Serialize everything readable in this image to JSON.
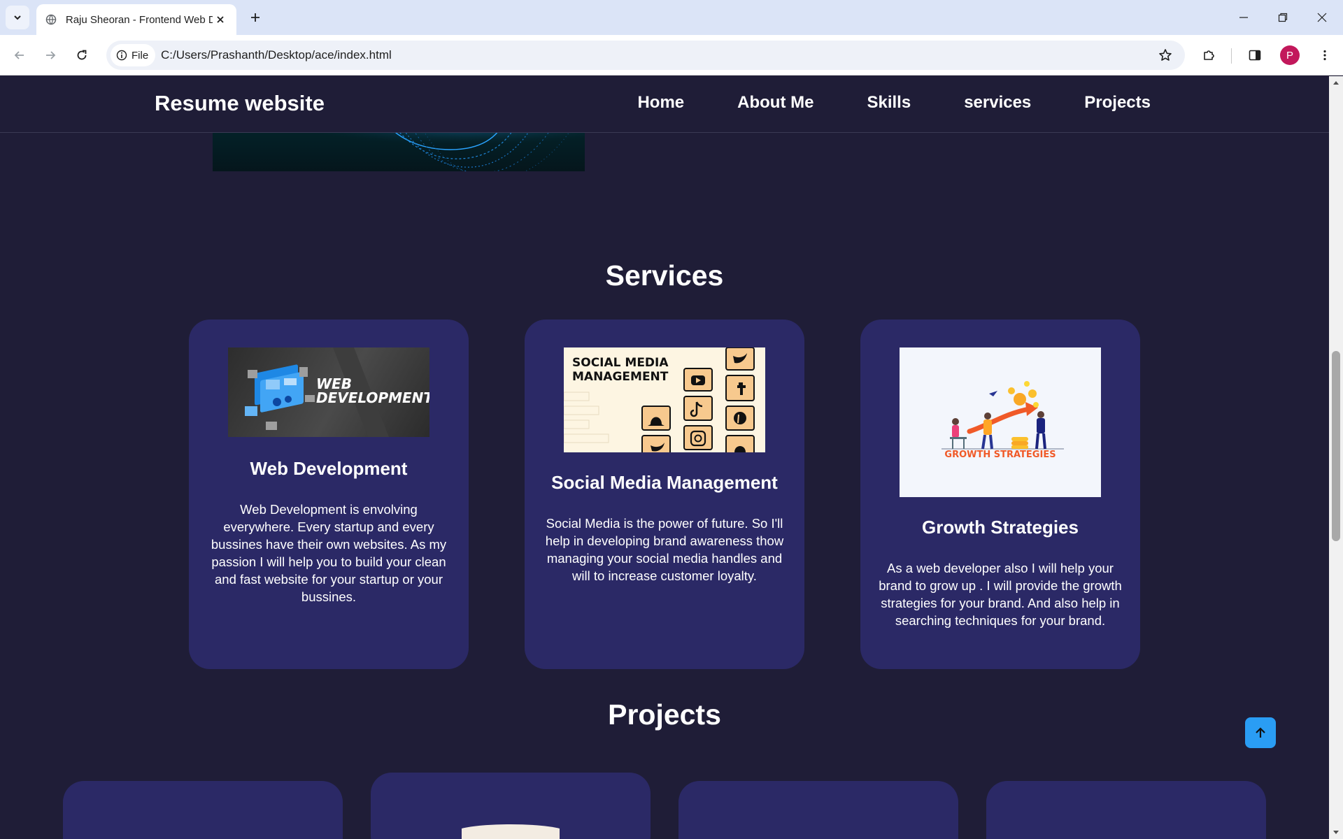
{
  "browser": {
    "tab_title": "Raju Sheoran - Frontend Web D",
    "chip_label": "File",
    "url": "C:/Users/Prashanth/Desktop/ace/index.html",
    "profile_initial": "P"
  },
  "site": {
    "brand": "Resume website",
    "nav": [
      "Home",
      "About Me",
      "Skills",
      "services",
      "Projects"
    ]
  },
  "services": {
    "title": "Services",
    "cards": [
      {
        "title": "Web Development",
        "image_text": [
          "WEB",
          "DEVELOPMENT"
        ],
        "description": "Web Development is envolving everywhere. Every startup and every bussines have their own websites. As my passion I will help you to build your clean and fast website for your startup or your bussines."
      },
      {
        "title": "Social Media Management",
        "image_text": [
          "SOCIAL MEDIA",
          "MANAGEMENT"
        ],
        "description": "Social Media is the power of future. So I'll help in developing brand awareness thow managing your social media handles and will to increase customer loyalty."
      },
      {
        "title": "Growth Strategies",
        "image_text": [
          "GROWTH STRATEGIES"
        ],
        "description": "As a web developer also I will help your brand to grow up . I will provide the growth strategies for your brand. And also help in searching techniques for your brand."
      }
    ]
  },
  "projects": {
    "title": "Projects"
  },
  "colors": {
    "page_bg": "#1f1d37",
    "card_bg": "#2b2966",
    "accent": "#2a9df4"
  }
}
